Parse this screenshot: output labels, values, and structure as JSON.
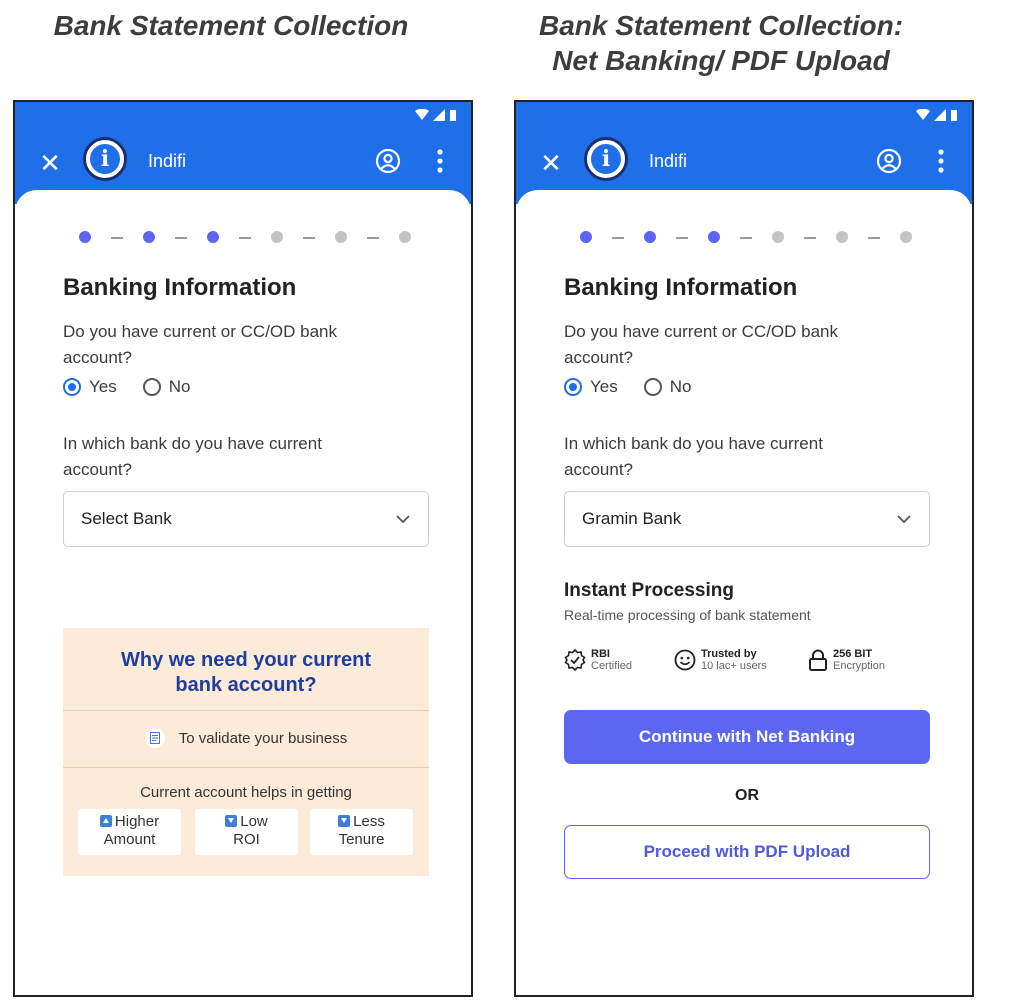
{
  "captions": {
    "left": "Bank Statement Collection",
    "right_line1": "Bank Statement Collection:",
    "right_line2": "Net Banking/ PDF Upload"
  },
  "colors": {
    "brand_blue": "#1f6fe8",
    "primary_button": "#5d66ef",
    "info_bg": "#fcebd9",
    "step_active": "#5d66ef",
    "step_inactive": "#c4c4c4"
  },
  "app": {
    "name": "Indifi",
    "close_icon": "close-icon",
    "profile_icon": "profile-icon",
    "menu_icon": "more-vert-icon"
  },
  "stepper": {
    "total": 6,
    "completed": 3
  },
  "left_screen": {
    "title": "Banking Information",
    "question1": "Do you have current or CC/OD bank account?",
    "yes_label": "Yes",
    "no_label": "No",
    "selected": "Yes",
    "question2": "In which bank do you have current account?",
    "bank_select_value": "Select Bank",
    "info": {
      "heading": "Why we need your current bank account?",
      "reason": "To validate your business",
      "helps_heading": "Current account helps in getting",
      "benefits": [
        {
          "label_top": "Higher",
          "label_bottom": "Amount",
          "direction": "up"
        },
        {
          "label_top": "Low",
          "label_bottom": "ROI",
          "direction": "down"
        },
        {
          "label_top": "Less",
          "label_bottom": "Tenure",
          "direction": "down"
        }
      ]
    }
  },
  "right_screen": {
    "title": "Banking Information",
    "question1": "Do you have current or CC/OD bank account?",
    "yes_label": "Yes",
    "no_label": "No",
    "selected": "Yes",
    "question2": "In which bank do you have current account?",
    "bank_select_value": "Gramin Bank",
    "instant_title": "Instant Processing",
    "instant_sub": "Real-time processing of bank statement",
    "badges": [
      {
        "t1": "RBI",
        "t2": "Certified",
        "icon": "certified-badge-icon"
      },
      {
        "t1": "Trusted by",
        "t2": "10 lac+ users",
        "icon": "smile-icon"
      },
      {
        "t1": "256 BIT",
        "t2": "Encryption",
        "icon": "lock-icon"
      }
    ],
    "net_banking_button": "Continue with Net Banking",
    "or_text": "OR",
    "pdf_button": "Proceed with PDF Upload"
  }
}
